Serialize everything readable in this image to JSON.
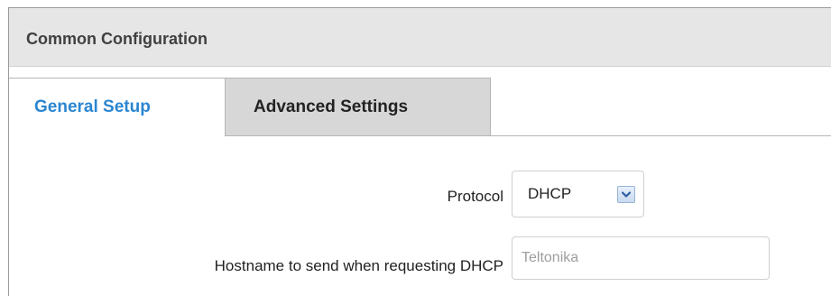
{
  "section": {
    "title": "Common Configuration"
  },
  "tabs": [
    {
      "label": "General Setup",
      "active": true
    },
    {
      "label": "Advanced Settings",
      "active": false
    }
  ],
  "form": {
    "protocol": {
      "label": "Protocol",
      "value": "DHCP"
    },
    "hostname": {
      "label": "Hostname to send when requesting DHCP",
      "value": "",
      "placeholder": "Teltonika"
    }
  },
  "colors": {
    "active_tab_text": "#2b86d1",
    "header_background": "#e6e6e6",
    "inactive_tab_background": "#d7d7d7"
  },
  "icons": {
    "select_arrow": "chevron-down-icon"
  }
}
